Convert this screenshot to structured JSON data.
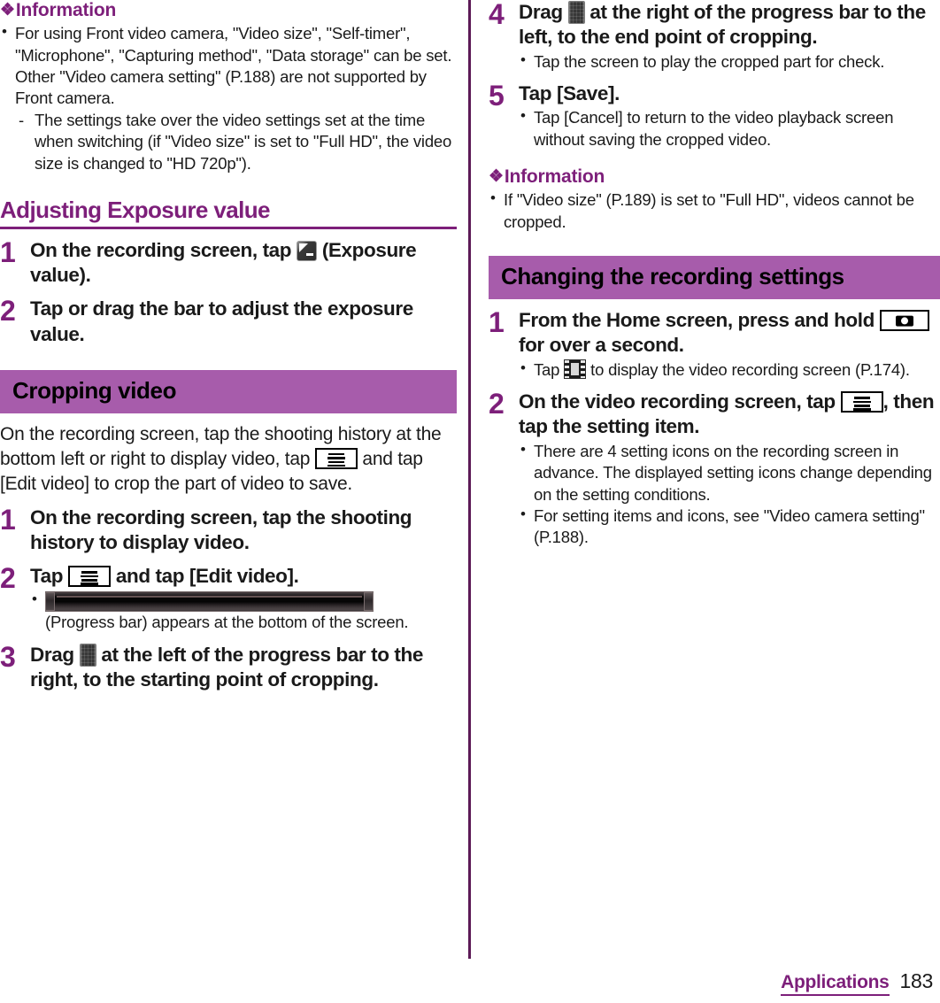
{
  "document": {
    "footer": {
      "chapter": "Applications",
      "page_number": "183"
    }
  },
  "left_column": {
    "information_1": {
      "diamond": "❖",
      "title": "Information",
      "bullets": [
        "For using Front video camera, \"Video size\", \"Self-timer\", \"Microphone\", \"Capturing method\", \"Data storage\" can be set. Other \"Video camera setting\" (P.188) are not supported by Front camera."
      ],
      "subbullets": [
        "The settings take over the video settings set at the time when switching (if \"Video size\" is set to \"Full HD\", the video size is changed to \"HD 720p\")."
      ]
    },
    "section_exposure": {
      "title": "Adjusting Exposure value",
      "steps": [
        {
          "number": "1",
          "title_before": "On the recording screen, tap",
          "icon": "exposure-value-icon",
          "title_after": "(Exposure value)."
        },
        {
          "number": "2",
          "title_before": "Tap or drag the bar to adjust the exposure value.",
          "icon": "",
          "title_after": ""
        }
      ]
    },
    "section_cropping": {
      "band_title": "Cropping video",
      "intro_part1": "On the recording screen, tap the shooting history at the bottom left or right to display video, tap",
      "intro_icon": "menu-icon",
      "intro_part2": "and tap [Edit video] to crop the part of video to save.",
      "steps": [
        {
          "number": "1",
          "title": "On the recording screen, tap the shooting history to display video."
        },
        {
          "number": "2",
          "title_before": "Tap",
          "icon": "menu-icon",
          "title_after": "and tap [Edit video].",
          "note_image": "progress-bar-screenshot",
          "note_text": "(Progress bar) appears at the bottom of the screen."
        },
        {
          "number": "3",
          "title_before": "Drag",
          "icon": "drag-handle-icon",
          "title_after": "at the left of the progress bar to the right, to the starting point of cropping."
        }
      ]
    }
  },
  "right_column": {
    "steps_cropping_cont": [
      {
        "number": "4",
        "title_before": "Drag",
        "icon": "drag-handle-icon",
        "title_after": "at the right of the progress bar to the left, to the end point of cropping.",
        "notes": [
          "Tap the screen to play the cropped part for check."
        ]
      },
      {
        "number": "5",
        "title": "Tap [Save].",
        "notes": [
          "Tap [Cancel] to return to the video playback screen without saving the cropped video."
        ]
      }
    ],
    "information_2": {
      "diamond": "❖",
      "title": "Information",
      "bullets": [
        "If \"Video size\" (P.189) is set to \"Full HD\", videos cannot be cropped."
      ]
    },
    "section_settings": {
      "band_title": "Changing the recording settings",
      "steps": [
        {
          "number": "1",
          "title_before": "From the Home screen, press and hold",
          "icon": "camera-key-icon",
          "title_after": "for over a second.",
          "note_before": "Tap",
          "note_icon": "film-strip-icon",
          "note_after": "to display the video recording screen (P.174)."
        },
        {
          "number": "2",
          "title_before": "On the video recording screen, tap",
          "icon": "menu-icon",
          "title_after": ", then tap the setting item.",
          "notes": [
            "There are 4 setting icons on the recording screen in advance. The displayed setting icons change depending on the setting conditions.",
            "For setting items and icons, see \"Video camera setting\" (P.188)."
          ]
        }
      ]
    }
  },
  "colors": {
    "accent_purple": "#7d1f7a",
    "band_purple": "#a75cab",
    "divider_purple": "#5c1a56",
    "text_black": "#1a1a1a"
  }
}
